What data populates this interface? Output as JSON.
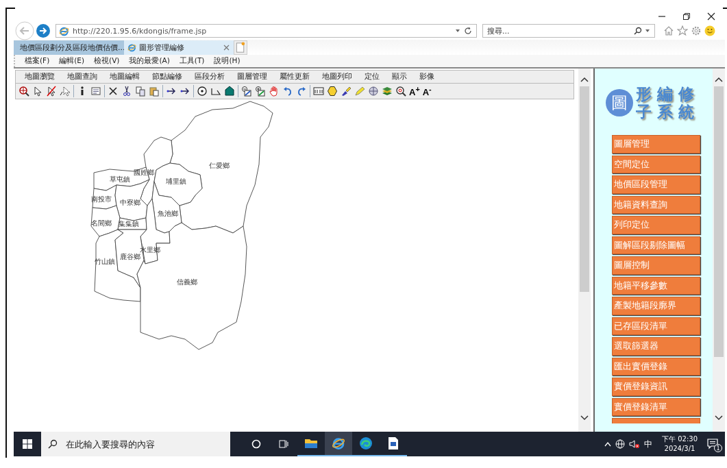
{
  "browser": {
    "url": "http://220.1.95.6/kdongis/frame.jsp",
    "search": {
      "placeholder": "搜尋..."
    }
  },
  "tabs": [
    {
      "label": "地價區段劃分及區段地價估價...",
      "selected": false
    },
    {
      "label": "圖形管理編修",
      "selected": true
    }
  ],
  "menu_bar": [
    "檔案(F)",
    "編輯(E)",
    "檢視(V)",
    "我的最愛(A)",
    "工具(T)",
    "說明(H)"
  ],
  "app_menu": [
    "地圖瀏覽",
    "地圖查詢",
    "地圖編輯",
    "節點編修",
    "區段分析",
    "圖層管理",
    "屬性更新",
    "地圖列印",
    "定位",
    "顯示",
    "影像"
  ],
  "font_tools": [
    "A$^{+}$",
    "A$^{-}$"
  ],
  "map": {
    "districts": [
      "仁愛鄉",
      "國姓鄉",
      "埔里鎮",
      "草屯鎮",
      "南投市",
      "中寮鄉",
      "魚池鄉",
      "名間鄉",
      "集集鎮",
      "水里鄉",
      "竹山鎮",
      "鹿谷鄉",
      "信義鄉"
    ]
  },
  "sidebar": {
    "logo": {
      "badge": "圖",
      "lines": [
        "形 編 修",
        "子 系 統"
      ]
    },
    "buttons": [
      "圖層管理",
      "空間定位",
      "地價區段管理",
      "地籍資料查詢",
      "列印定位",
      "圖解區段剔除圖幅",
      "圖層控制",
      "地籍平移參數",
      "產製地籍段廓界",
      "已存區段清單",
      "選取篩選器",
      "匯出實價登錄",
      "實價登錄資訊",
      "實價登錄清單"
    ],
    "partial_button": true
  },
  "taskbar": {
    "search": {
      "placeholder": "在此輸入要搜尋的內容"
    },
    "ime": "中",
    "time": "下午 02:30",
    "date": "2024/3/1",
    "notifications": "1"
  }
}
